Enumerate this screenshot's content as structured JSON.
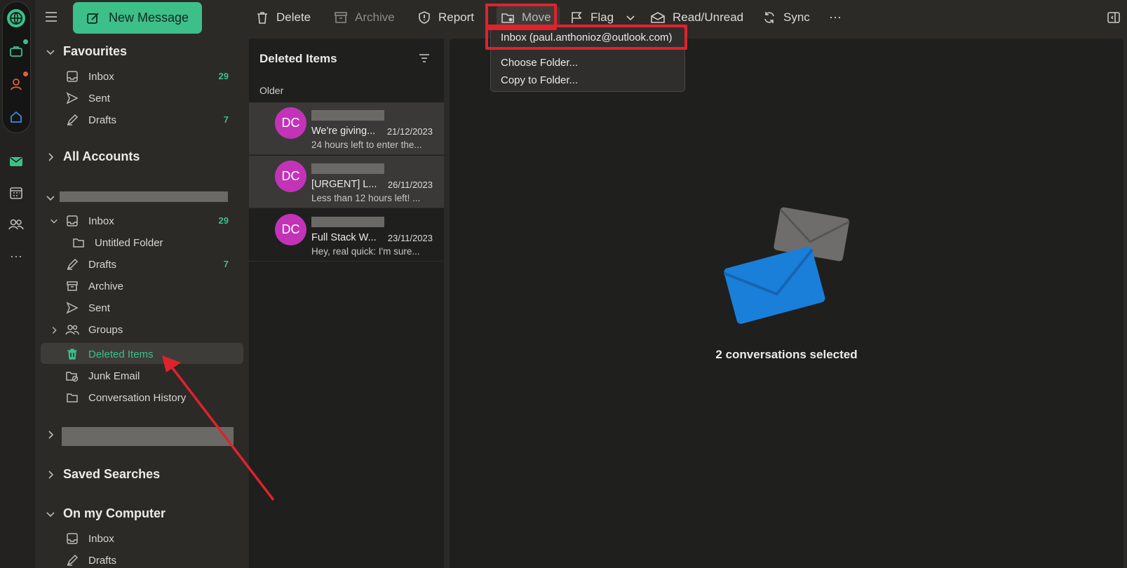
{
  "toolbar": {
    "new_message": "New Message",
    "delete": "Delete",
    "archive": "Archive",
    "report": "Report",
    "move": "Move",
    "flag": "Flag",
    "read_unread": "Read/Unread",
    "sync": "Sync",
    "more": "···"
  },
  "move_menu": {
    "items": [
      "Inbox (paul.anthonioz@outlook.com)",
      "Choose Folder...",
      "Copy to Folder..."
    ]
  },
  "sidebar": {
    "favourites": {
      "title": "Favourites",
      "items": [
        {
          "label": "Inbox",
          "count": "29"
        },
        {
          "label": "Sent",
          "count": ""
        },
        {
          "label": "Drafts",
          "count": "7"
        }
      ]
    },
    "all_accounts": "All Accounts",
    "account": {
      "items": [
        {
          "label": "Inbox",
          "count": "29"
        },
        {
          "label": "Untitled Folder",
          "count": ""
        },
        {
          "label": "Drafts",
          "count": "7"
        },
        {
          "label": "Archive",
          "count": ""
        },
        {
          "label": "Sent",
          "count": ""
        },
        {
          "label": "Groups",
          "count": ""
        },
        {
          "label": "Deleted Items",
          "count": ""
        },
        {
          "label": "Junk Email",
          "count": ""
        },
        {
          "label": "Conversation History",
          "count": ""
        }
      ]
    },
    "saved_searches": "Saved Searches",
    "on_my_computer": {
      "title": "On my Computer",
      "items": [
        {
          "label": "Inbox"
        },
        {
          "label": "Drafts"
        }
      ]
    }
  },
  "message_list": {
    "title": "Deleted Items",
    "group": "Older",
    "messages": [
      {
        "initials": "DC",
        "subject": "We're giving...",
        "date": "21/12/2023",
        "preview": "24 hours left to enter the..."
      },
      {
        "initials": "DC",
        "subject": "[URGENT] L...",
        "date": "26/11/2023",
        "preview": "Less than 12 hours left! ..."
      },
      {
        "initials": "DC",
        "subject": "Full Stack W...",
        "date": "23/11/2023",
        "preview": "Hey, real quick: I'm sure..."
      }
    ]
  },
  "reading_pane": {
    "status": "2 conversations selected"
  },
  "colors": {
    "accent": "#3dbf8a",
    "highlight": "#e0222c",
    "avatar": "#c233b8",
    "envelope_front": "#1a7fd9",
    "envelope_back": "#6e6d6b"
  }
}
